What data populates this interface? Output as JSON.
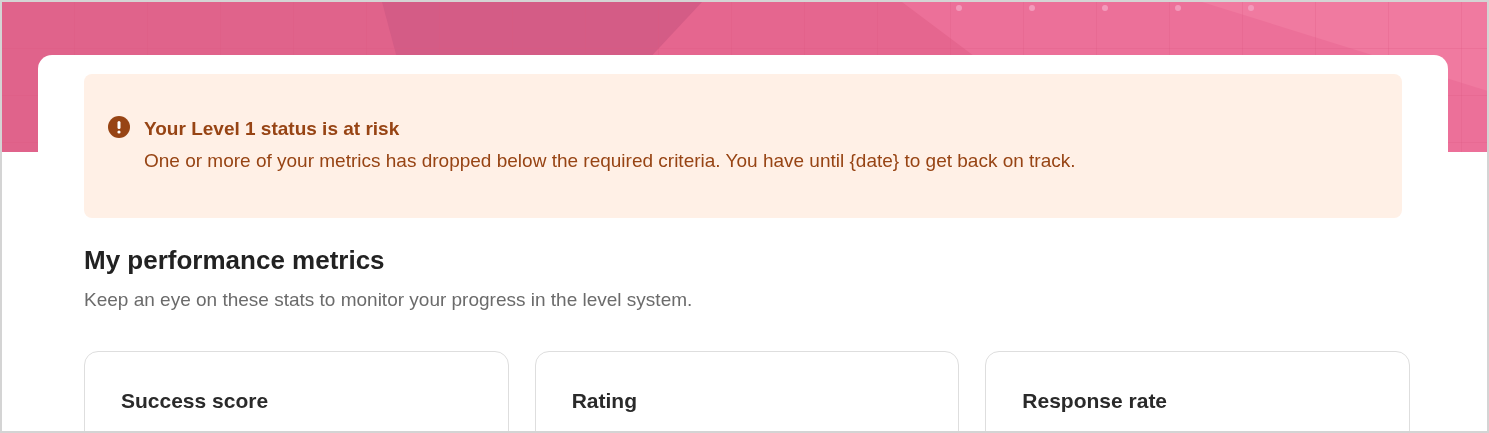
{
  "alert": {
    "title": "Your Level 1 status is at risk",
    "message": "One or more of your metrics has dropped below the required criteria. You have until {date} to get back on track."
  },
  "section": {
    "title": "My performance metrics",
    "subtitle": "Keep an eye on these stats to monitor your progress in the level system."
  },
  "metrics": [
    {
      "title": "Success score"
    },
    {
      "title": "Rating"
    },
    {
      "title": "Response rate"
    }
  ]
}
